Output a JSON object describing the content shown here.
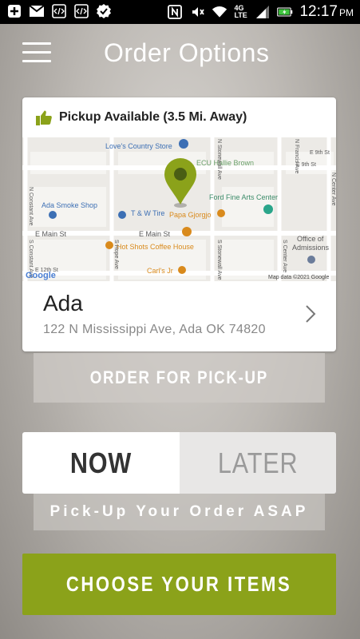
{
  "status_bar": {
    "time": "12:17",
    "ampm": "PM",
    "network": "4G LTE",
    "left_icons": [
      "plus-icon",
      "gmail-icon",
      "code-icon",
      "code-icon",
      "check-badge-icon"
    ],
    "right_icons": [
      "nfc-icon",
      "mute-icon",
      "wifi-icon",
      "signal-icon",
      "battery-icon"
    ]
  },
  "header": {
    "title": "Order Options",
    "menu_icon": "hamburger-menu-icon"
  },
  "location_card": {
    "pickup_label": "Pickup Available (3.5 Mi. Away)",
    "pickup_icon": "thumbs-up-icon",
    "accent_color": "#8ba21a",
    "map": {
      "labels": {
        "loves": "Love's Country Store",
        "ecu1": "ECU Hallie Brown",
        "ecu2": "Ford Fine Arts Center",
        "smoke": "Ada Smoke Shop",
        "tire": "T & W Tire",
        "papa": "Papa Gjorgjo",
        "main_w": "E Main St",
        "main_e": "E Main St",
        "office1": "Office of",
        "office2": "Admissions",
        "hotshots": "Hot Shots Coffee House",
        "carls": "Carl's Jr",
        "ninth": "E 9th St",
        "ninth2": "E 9th St",
        "twelfth": "E 12th St",
        "stonewall_n": "N Stonewall Ave",
        "stonewall_s": "S Stonewall Ave",
        "francis": "N Francis Ave",
        "constant_n": "N Constant Ave",
        "constant_s": "S Constant Ave",
        "hope": "S Hope Ave",
        "center_s": "S Center Ave",
        "center_n": "N Center Ave",
        "google": "Google",
        "mapdata": "Map data ©2021 Google"
      }
    },
    "store_name": "Ada",
    "store_address": "122 N Mississippi Ave, Ada OK 74820"
  },
  "order_type_button": "ORDER FOR PICK-UP",
  "timing": {
    "now": "NOW",
    "later": "LATER",
    "selected": "NOW"
  },
  "asap_text": "Pick-Up Your Order ASAP",
  "choose_button": "CHOOSE YOUR ITEMS"
}
